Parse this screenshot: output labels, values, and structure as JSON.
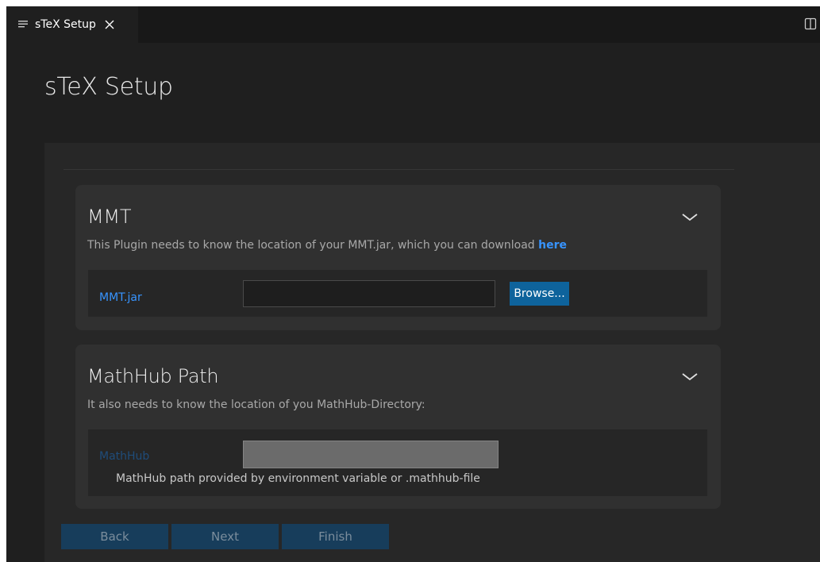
{
  "tab": {
    "title": "sTeX Setup",
    "icon": "lines-icon",
    "close_icon": "close-icon"
  },
  "toolbar": {
    "split_icon": "split-editor-icon"
  },
  "page": {
    "title": "sTeX Setup"
  },
  "sections": {
    "mmt": {
      "title": "MMT",
      "description": "This Plugin needs to know the location of your MMT.jar, which you can download",
      "link_text": "here",
      "field_label": "MMT.jar",
      "field_value": "",
      "browse_label": "Browse..."
    },
    "mathhub": {
      "title": "MathHub Path",
      "description": "It also needs to know the location of you MathHub-Directory:",
      "field_label": "MathHub",
      "field_value": "",
      "hint": "MathHub path provided by environment variable or .mathhub-file"
    }
  },
  "footer": {
    "back_label": "Back",
    "next_label": "Next",
    "finish_label": "Finish"
  },
  "colors": {
    "accent_link": "#3794ff",
    "primary_button": "#0e639c",
    "disabled_button": "#173d5b"
  }
}
